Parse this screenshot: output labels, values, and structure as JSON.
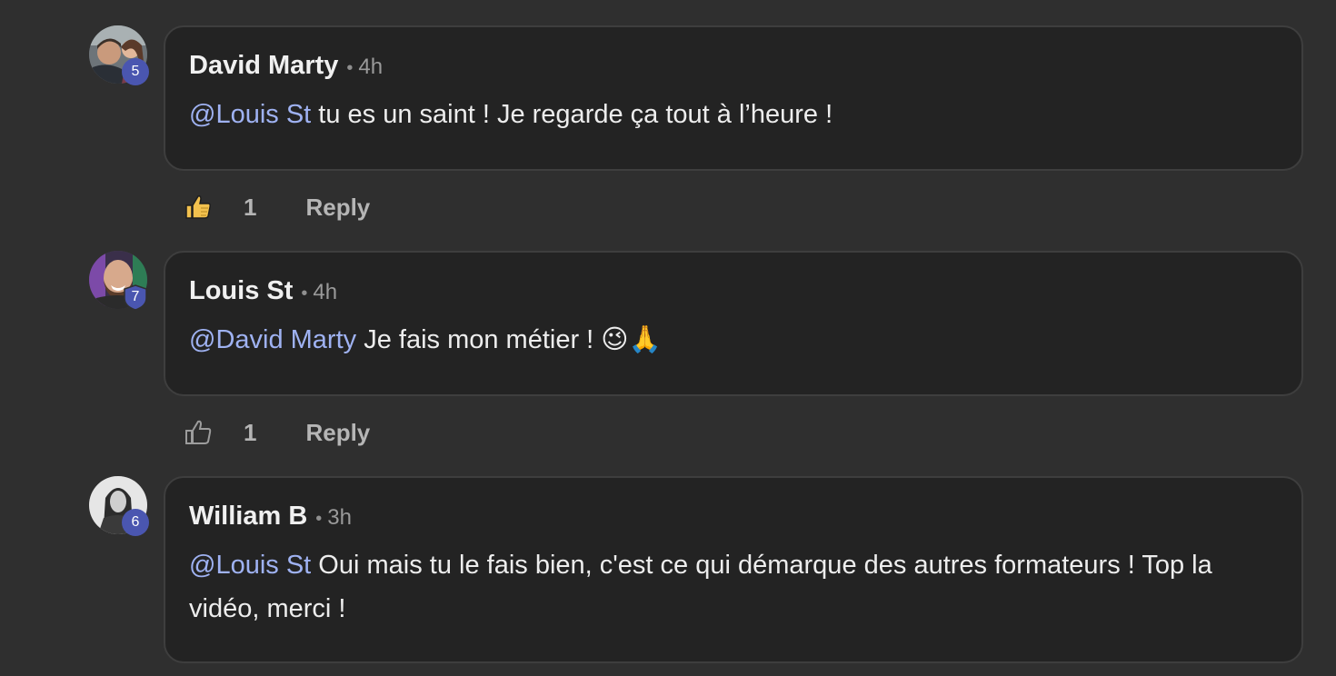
{
  "comments": [
    {
      "author": "David Marty",
      "separator": "•",
      "time": "4h",
      "level": "5",
      "mention": "@Louis St",
      "text": " tu es un saint ! Je regarde ça tout à l’heure !",
      "likes": "1",
      "liked": true,
      "reply_label": "Reply"
    },
    {
      "author": "Louis St",
      "separator": "•",
      "time": "4h",
      "level": "7",
      "mention": "@David Marty",
      "text": " Je fais mon métier ! 😉🙏",
      "likes": "1",
      "liked": false,
      "reply_label": "Reply"
    },
    {
      "author": "William B",
      "separator": "•",
      "time": "3h",
      "level": "6",
      "mention": "@Louis St",
      "text": " Oui mais tu le fais bien, c'est ce qui démarque des autres formateurs ! Top la vidéo, merci !",
      "likes": "",
      "liked": false,
      "reply_label": ""
    }
  ],
  "colors": {
    "background": "#2f2f2f",
    "bubble": "#232323",
    "mention": "#9fb2f2",
    "level_badge": "#4a56b0",
    "like_active": "#f2c14e"
  },
  "icons": {
    "liked": "thumbs-up-filled-icon",
    "not_liked": "thumbs-up-outline-icon"
  }
}
